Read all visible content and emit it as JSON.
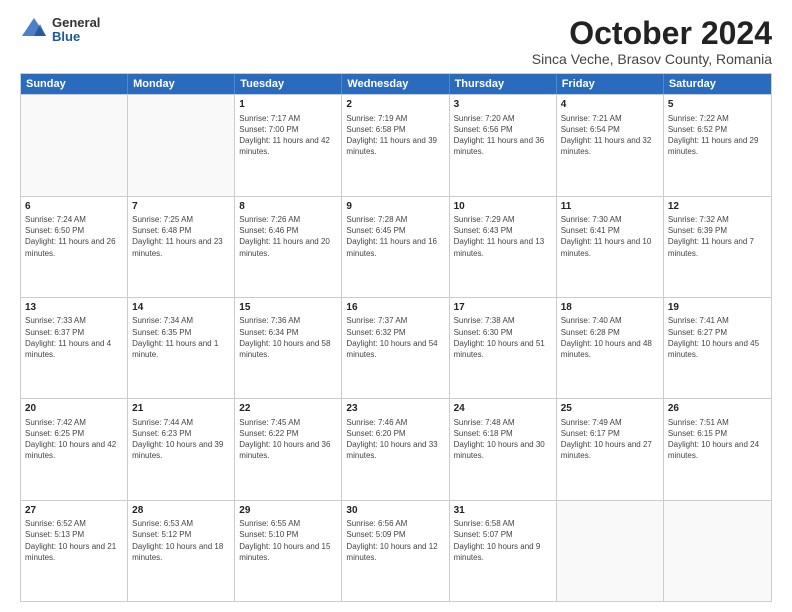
{
  "logo": {
    "general": "General",
    "blue": "Blue"
  },
  "title": {
    "month": "October 2024",
    "location": "Sinca Veche, Brasov County, Romania"
  },
  "headers": [
    "Sunday",
    "Monday",
    "Tuesday",
    "Wednesday",
    "Thursday",
    "Friday",
    "Saturday"
  ],
  "weeks": [
    [
      {
        "day": "",
        "content": "",
        "empty": true
      },
      {
        "day": "",
        "content": "",
        "empty": true
      },
      {
        "day": "1",
        "content": "Sunrise: 7:17 AM\nSunset: 7:00 PM\nDaylight: 11 hours and 42 minutes."
      },
      {
        "day": "2",
        "content": "Sunrise: 7:19 AM\nSunset: 6:58 PM\nDaylight: 11 hours and 39 minutes."
      },
      {
        "day": "3",
        "content": "Sunrise: 7:20 AM\nSunset: 6:56 PM\nDaylight: 11 hours and 36 minutes."
      },
      {
        "day": "4",
        "content": "Sunrise: 7:21 AM\nSunset: 6:54 PM\nDaylight: 11 hours and 32 minutes."
      },
      {
        "day": "5",
        "content": "Sunrise: 7:22 AM\nSunset: 6:52 PM\nDaylight: 11 hours and 29 minutes."
      }
    ],
    [
      {
        "day": "6",
        "content": "Sunrise: 7:24 AM\nSunset: 6:50 PM\nDaylight: 11 hours and 26 minutes."
      },
      {
        "day": "7",
        "content": "Sunrise: 7:25 AM\nSunset: 6:48 PM\nDaylight: 11 hours and 23 minutes."
      },
      {
        "day": "8",
        "content": "Sunrise: 7:26 AM\nSunset: 6:46 PM\nDaylight: 11 hours and 20 minutes."
      },
      {
        "day": "9",
        "content": "Sunrise: 7:28 AM\nSunset: 6:45 PM\nDaylight: 11 hours and 16 minutes."
      },
      {
        "day": "10",
        "content": "Sunrise: 7:29 AM\nSunset: 6:43 PM\nDaylight: 11 hours and 13 minutes."
      },
      {
        "day": "11",
        "content": "Sunrise: 7:30 AM\nSunset: 6:41 PM\nDaylight: 11 hours and 10 minutes."
      },
      {
        "day": "12",
        "content": "Sunrise: 7:32 AM\nSunset: 6:39 PM\nDaylight: 11 hours and 7 minutes."
      }
    ],
    [
      {
        "day": "13",
        "content": "Sunrise: 7:33 AM\nSunset: 6:37 PM\nDaylight: 11 hours and 4 minutes."
      },
      {
        "day": "14",
        "content": "Sunrise: 7:34 AM\nSunset: 6:35 PM\nDaylight: 11 hours and 1 minute."
      },
      {
        "day": "15",
        "content": "Sunrise: 7:36 AM\nSunset: 6:34 PM\nDaylight: 10 hours and 58 minutes."
      },
      {
        "day": "16",
        "content": "Sunrise: 7:37 AM\nSunset: 6:32 PM\nDaylight: 10 hours and 54 minutes."
      },
      {
        "day": "17",
        "content": "Sunrise: 7:38 AM\nSunset: 6:30 PM\nDaylight: 10 hours and 51 minutes."
      },
      {
        "day": "18",
        "content": "Sunrise: 7:40 AM\nSunset: 6:28 PM\nDaylight: 10 hours and 48 minutes."
      },
      {
        "day": "19",
        "content": "Sunrise: 7:41 AM\nSunset: 6:27 PM\nDaylight: 10 hours and 45 minutes."
      }
    ],
    [
      {
        "day": "20",
        "content": "Sunrise: 7:42 AM\nSunset: 6:25 PM\nDaylight: 10 hours and 42 minutes."
      },
      {
        "day": "21",
        "content": "Sunrise: 7:44 AM\nSunset: 6:23 PM\nDaylight: 10 hours and 39 minutes."
      },
      {
        "day": "22",
        "content": "Sunrise: 7:45 AM\nSunset: 6:22 PM\nDaylight: 10 hours and 36 minutes."
      },
      {
        "day": "23",
        "content": "Sunrise: 7:46 AM\nSunset: 6:20 PM\nDaylight: 10 hours and 33 minutes."
      },
      {
        "day": "24",
        "content": "Sunrise: 7:48 AM\nSunset: 6:18 PM\nDaylight: 10 hours and 30 minutes."
      },
      {
        "day": "25",
        "content": "Sunrise: 7:49 AM\nSunset: 6:17 PM\nDaylight: 10 hours and 27 minutes."
      },
      {
        "day": "26",
        "content": "Sunrise: 7:51 AM\nSunset: 6:15 PM\nDaylight: 10 hours and 24 minutes."
      }
    ],
    [
      {
        "day": "27",
        "content": "Sunrise: 6:52 AM\nSunset: 5:13 PM\nDaylight: 10 hours and 21 minutes."
      },
      {
        "day": "28",
        "content": "Sunrise: 6:53 AM\nSunset: 5:12 PM\nDaylight: 10 hours and 18 minutes."
      },
      {
        "day": "29",
        "content": "Sunrise: 6:55 AM\nSunset: 5:10 PM\nDaylight: 10 hours and 15 minutes."
      },
      {
        "day": "30",
        "content": "Sunrise: 6:56 AM\nSunset: 5:09 PM\nDaylight: 10 hours and 12 minutes."
      },
      {
        "day": "31",
        "content": "Sunrise: 6:58 AM\nSunset: 5:07 PM\nDaylight: 10 hours and 9 minutes."
      },
      {
        "day": "",
        "content": "",
        "empty": true
      },
      {
        "day": "",
        "content": "",
        "empty": true
      }
    ]
  ]
}
